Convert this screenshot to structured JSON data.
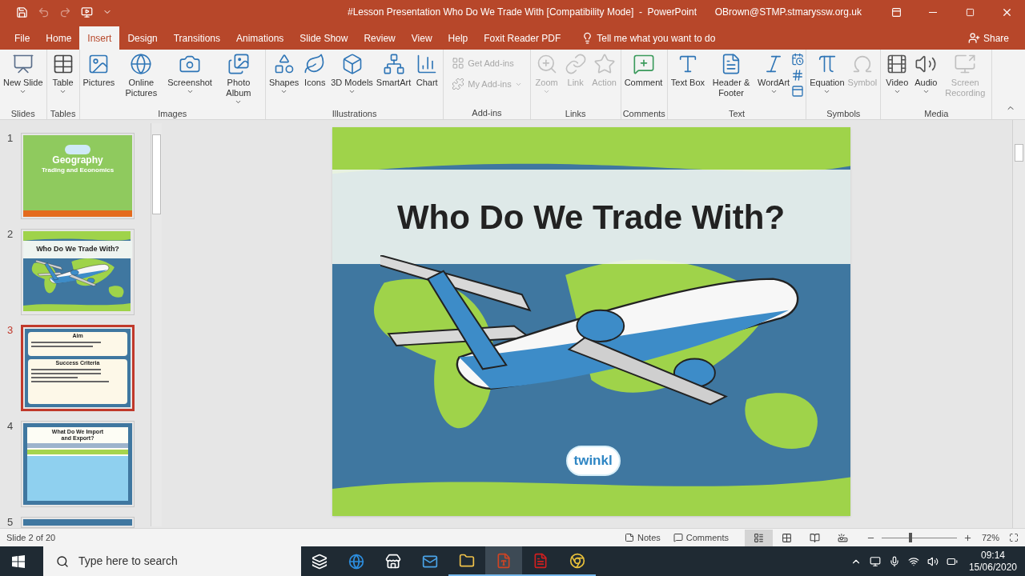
{
  "title_bar": {
    "title": "#Lesson Presentation Who Do We Trade With [Compatibility Mode]  -  PowerPoint",
    "account": "OBrown@STMP.stmaryssw.org.uk",
    "quick_access": [
      {
        "disabled": false
      },
      {
        "disabled": true
      },
      {
        "disabled": true
      },
      {
        "disabled": false
      }
    ]
  },
  "tabs": [
    {
      "label": "File",
      "selected": false
    },
    {
      "label": "Home",
      "selected": false
    },
    {
      "label": "Insert",
      "selected": true
    },
    {
      "label": "Design",
      "selected": false
    },
    {
      "label": "Transitions",
      "selected": false
    },
    {
      "label": "Animations",
      "selected": false
    },
    {
      "label": "Slide Show",
      "selected": false
    },
    {
      "label": "Review",
      "selected": false
    },
    {
      "label": "View",
      "selected": false
    },
    {
      "label": "Help",
      "selected": false
    },
    {
      "label": "Foxit Reader PDF",
      "selected": false
    }
  ],
  "tell_me": "Tell me what you want to do",
  "share": "Share",
  "ribbon_groups": [
    {
      "label": "Slides",
      "commands": [
        {
          "label": "New Slide",
          "kind": "large",
          "dropdown": true,
          "disabled": false
        }
      ]
    },
    {
      "label": "Tables",
      "commands": [
        {
          "label": "Table",
          "kind": "large",
          "dropdown": true,
          "disabled": false
        }
      ]
    },
    {
      "label": "Images",
      "commands": [
        {
          "label": "Pictures",
          "kind": "large",
          "dropdown": false,
          "disabled": false
        },
        {
          "label": "Online Pictures",
          "kind": "large",
          "dropdown": false,
          "disabled": false
        },
        {
          "label": "Screenshot",
          "kind": "large",
          "dropdown": true,
          "disabled": false
        },
        {
          "label": "Photo Album",
          "kind": "large",
          "dropdown": true,
          "disabled": false
        }
      ]
    },
    {
      "label": "Illustrations",
      "commands": [
        {
          "label": "Shapes",
          "kind": "large",
          "dropdown": true,
          "disabled": false
        },
        {
          "label": "Icons",
          "kind": "large",
          "dropdown": false,
          "disabled": false
        },
        {
          "label": "3D Models",
          "kind": "large",
          "dropdown": true,
          "disabled": false
        },
        {
          "label": "SmartArt",
          "kind": "large",
          "dropdown": false,
          "disabled": false
        },
        {
          "label": "Chart",
          "kind": "large",
          "dropdown": false,
          "disabled": false
        }
      ]
    },
    {
      "label": "Add-ins",
      "commands": [
        {
          "label": "Get Add-ins",
          "kind": "small",
          "dropdown": false,
          "disabled": true
        },
        {
          "label": "My Add-ins",
          "kind": "small",
          "dropdown": true,
          "disabled": true
        }
      ]
    },
    {
      "label": "Links",
      "commands": [
        {
          "label": "Zoom",
          "kind": "large",
          "dropdown": true,
          "disabled": true
        },
        {
          "label": "Link",
          "kind": "large",
          "dropdown": false,
          "disabled": true
        },
        {
          "label": "Action",
          "kind": "large",
          "dropdown": false,
          "disabled": true
        }
      ]
    },
    {
      "label": "Comments",
      "commands": [
        {
          "label": "Comment",
          "kind": "large",
          "dropdown": false,
          "disabled": false
        }
      ]
    },
    {
      "label": "Text",
      "commands": [
        {
          "label": "Text Box",
          "kind": "large",
          "dropdown": false,
          "disabled": false
        },
        {
          "label": "Header & Footer",
          "kind": "large",
          "dropdown": false,
          "disabled": false
        },
        {
          "label": "WordArt",
          "kind": "large",
          "dropdown": true,
          "disabled": false
        },
        {
          "kind": "icons",
          "disabled": false
        }
      ]
    },
    {
      "label": "Symbols",
      "commands": [
        {
          "label": "Equation",
          "kind": "large",
          "dropdown": true,
          "disabled": false
        },
        {
          "label": "Symbol",
          "kind": "large",
          "dropdown": false,
          "disabled": true
        }
      ]
    },
    {
      "label": "Media",
      "commands": [
        {
          "label": "Video",
          "kind": "large",
          "dropdown": true,
          "disabled": false
        },
        {
          "label": "Audio",
          "kind": "large",
          "dropdown": true,
          "disabled": false
        },
        {
          "label": "Screen Recording",
          "kind": "large",
          "dropdown": false,
          "disabled": true
        }
      ]
    }
  ],
  "thumbnails": [
    {
      "number": "1",
      "selected": false,
      "kind": "title",
      "title": "Geography",
      "subtitle": "Trading and Economics"
    },
    {
      "number": "2",
      "selected": false,
      "kind": "map_title",
      "title": "Who Do We Trade With?"
    },
    {
      "number": "3",
      "selected": true,
      "kind": "aim",
      "heading": "Aim",
      "heading_2": "Success Criteria"
    },
    {
      "number": "4",
      "selected": false,
      "kind": "import",
      "title": "What Do We Import and Export?"
    },
    {
      "number": "5",
      "selected": false,
      "kind": "partial"
    }
  ],
  "slide": {
    "title": "Who Do We Trade With?",
    "logo": "twinkl"
  },
  "status_bar": {
    "slide_info": "Slide 2 of 20",
    "notes": "Notes",
    "comments": "Comments",
    "views": [
      {
        "selected": true
      },
      {
        "selected": false
      },
      {
        "selected": false
      },
      {
        "selected": false
      }
    ],
    "zoom": {
      "level": 0.36,
      "reading": "72%"
    }
  },
  "taskbar": {
    "search_placeholder": "Type here to search",
    "time": "09:14",
    "date": "15/06/2020",
    "apps": [
      {
        "selected": false,
        "running": false
      },
      {
        "selected": false,
        "running": false
      },
      {
        "selected": false,
        "running": false
      },
      {
        "selected": false,
        "running": false
      },
      {
        "selected": false,
        "running": true
      },
      {
        "selected": true,
        "running": true
      },
      {
        "selected": false,
        "running": true
      },
      {
        "selected": false,
        "running": true
      }
    ]
  }
}
